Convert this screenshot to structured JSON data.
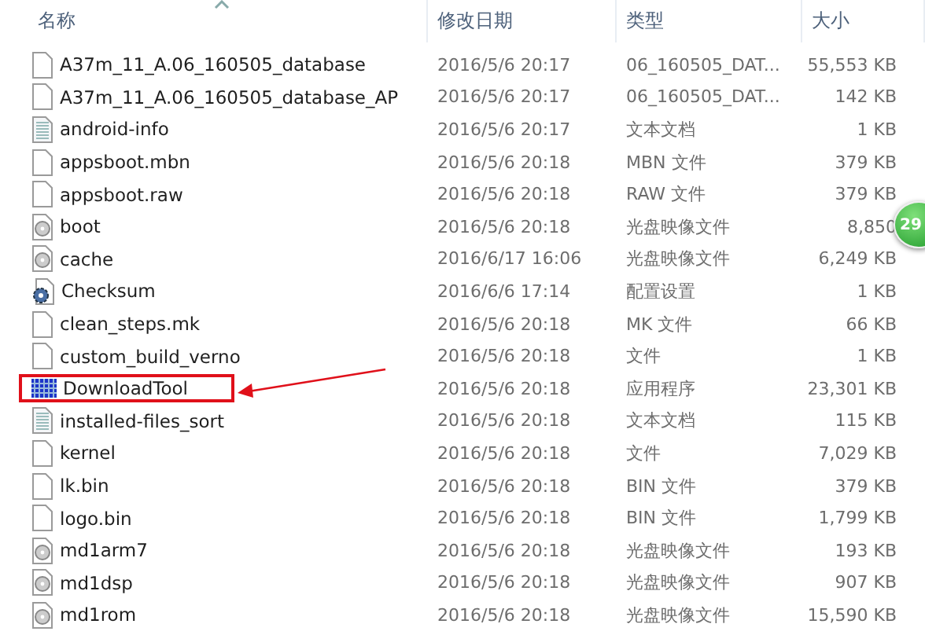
{
  "columns": [
    {
      "label": "名称",
      "sorted": true
    },
    {
      "label": "修改日期",
      "sorted": false
    },
    {
      "label": "类型",
      "sorted": false
    },
    {
      "label": "大小",
      "sorted": false
    }
  ],
  "files": [
    {
      "name": "A37m_11_A.06_160505_database",
      "kind": "file",
      "date": "2016/5/6 20:17",
      "type": "06_160505_DAT...",
      "size": "55,553 KB"
    },
    {
      "name": "A37m_11_A.06_160505_database_AP",
      "kind": "file",
      "date": "2016/5/6 20:17",
      "type": "06_160505_DAT...",
      "size": "142 KB"
    },
    {
      "name": "android-info",
      "kind": "text",
      "date": "2016/5/6 20:17",
      "type": "文本文档",
      "size": "1 KB"
    },
    {
      "name": "appsboot.mbn",
      "kind": "file",
      "date": "2016/5/6 20:18",
      "type": "MBN 文件",
      "size": "379 KB"
    },
    {
      "name": "appsboot.raw",
      "kind": "file",
      "date": "2016/5/6 20:18",
      "type": "RAW 文件",
      "size": "379 KB"
    },
    {
      "name": "boot",
      "kind": "disc",
      "date": "2016/5/6 20:18",
      "type": "光盘映像文件",
      "size": "8,850"
    },
    {
      "name": "cache",
      "kind": "disc",
      "date": "2016/6/17 16:06",
      "type": "光盘映像文件",
      "size": "6,249 KB"
    },
    {
      "name": "Checksum",
      "kind": "config",
      "date": "2016/6/6 17:14",
      "type": "配置设置",
      "size": "1 KB"
    },
    {
      "name": "clean_steps.mk",
      "kind": "file",
      "date": "2016/5/6 20:18",
      "type": "MK 文件",
      "size": "66 KB"
    },
    {
      "name": "custom_build_verno",
      "kind": "file",
      "date": "2016/5/6 20:18",
      "type": "文件",
      "size": "1 KB"
    },
    {
      "name": "DownloadTool",
      "kind": "app",
      "date": "2016/5/6 20:18",
      "type": "应用程序",
      "size": "23,301 KB",
      "highlighted": true
    },
    {
      "name": "installed-files_sort",
      "kind": "text",
      "date": "2016/5/6 20:18",
      "type": "文本文档",
      "size": "115 KB"
    },
    {
      "name": "kernel",
      "kind": "file",
      "date": "2016/5/6 20:18",
      "type": "文件",
      "size": "7,029 KB"
    },
    {
      "name": "lk.bin",
      "kind": "file",
      "date": "2016/5/6 20:18",
      "type": "BIN 文件",
      "size": "379 KB"
    },
    {
      "name": "logo.bin",
      "kind": "file",
      "date": "2016/5/6 20:18",
      "type": "BIN 文件",
      "size": "1,799 KB"
    },
    {
      "name": "md1arm7",
      "kind": "disc",
      "date": "2016/5/6 20:18",
      "type": "光盘映像文件",
      "size": "193 KB"
    },
    {
      "name": "md1dsp",
      "kind": "disc",
      "date": "2016/5/6 20:18",
      "type": "光盘映像文件",
      "size": "907 KB"
    },
    {
      "name": "md1rom",
      "kind": "disc",
      "date": "2016/5/6 20:18",
      "type": "光盘映像文件",
      "size": "15,590 KB"
    }
  ],
  "badge": {
    "text": "29"
  }
}
